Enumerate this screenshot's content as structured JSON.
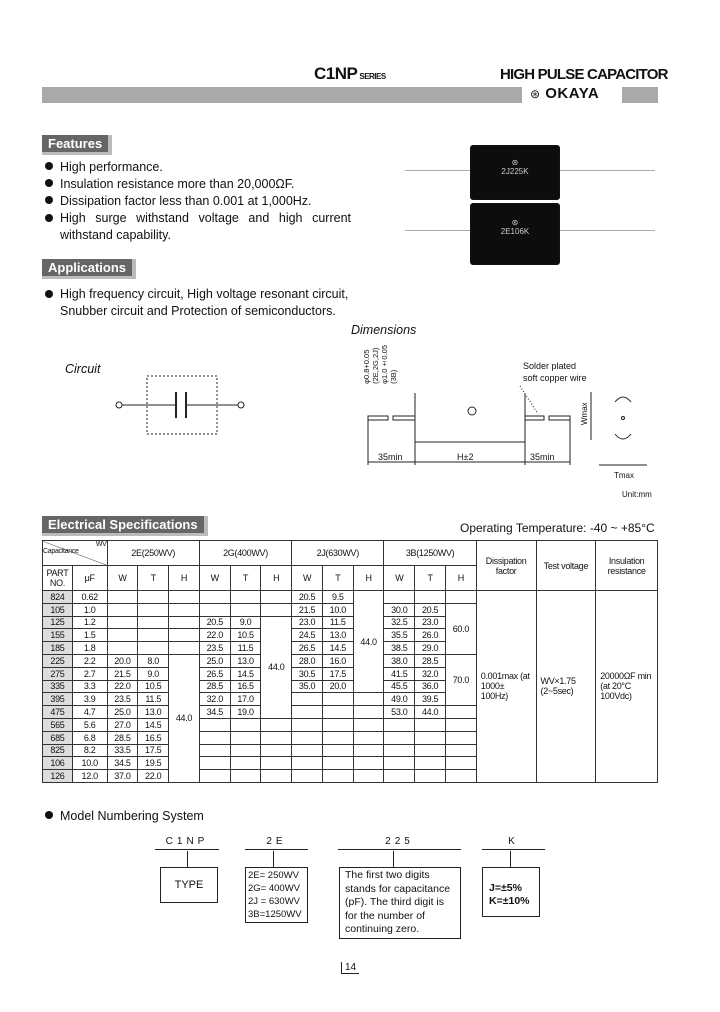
{
  "header": {
    "series": "C1NP",
    "series_suffix": "SERIES",
    "product_title": "HIGH PULSE CAPACITOR",
    "brand": "OKAYA",
    "bar_color": "#a9a9a9"
  },
  "features": {
    "title": "Features",
    "items": [
      "High performance.",
      "Insulation resistance more than 20,000ΩF.",
      "Dissipation factor less than 0.001 at 1,000Hz.",
      "High surge withstand voltage and high current withstand capability."
    ]
  },
  "photo": {
    "labels": [
      "2J225K",
      "2E106K"
    ]
  },
  "applications": {
    "title": "Applications",
    "text": "High frequency circuit, High voltage resonant circuit, Snubber circuit and Protection of semiconductors."
  },
  "circuit": {
    "label": "Circuit"
  },
  "dimensions": {
    "title": "Dimensions",
    "lead_dia_1": "φ0.8+0.05",
    "lead_dia_1_note": "(2E,2G,2J)",
    "lead_dia_2": "φ1.0±0.05",
    "lead_dia_2_note": "(3B)",
    "wire_note_1": "Solder plated",
    "wire_note_2": "soft copper wire",
    "lead_len_left": "35min",
    "body_len": "H±2",
    "lead_len_right": "35min",
    "wmax": "Wmax",
    "tmax": "Tmax",
    "unit": "Unit:mm"
  },
  "spec": {
    "title": "Electrical Specifications",
    "operating_temp": "Operating Temperature: -40 ~ +85°C",
    "corner_wv": "WV",
    "corner_cap": "Capacitance",
    "part_no": "PART NO.",
    "uf": "μF",
    "groups": [
      "2E(250WV)",
      "2G(400WV)",
      "2J(630WV)",
      "3B(1250WV)"
    ],
    "sub": [
      "W",
      "T",
      "H"
    ],
    "dissipation_header": "Dissipation factor",
    "test_header": "Test voltage",
    "insulation_header": "Insulation resistance",
    "dissipation": "0.001max (at 1000± 100Hz)",
    "test": "WV×1.75 (2~5sec)",
    "insulation": "20000ΩF min (at 20°C 100Vdc)",
    "h_2E": "44.0",
    "h_2G": "44.0",
    "h_2J": "44.0",
    "h_3B_a": "60.0",
    "h_3B_b": "70.0",
    "rows": [
      [
        "824",
        "0.62",
        "",
        "",
        "",
        "",
        "20.5",
        "9.5",
        "",
        ""
      ],
      [
        "105",
        "1.0",
        "",
        "",
        "",
        "",
        "21.5",
        "10.0",
        "30.0",
        "20.5"
      ],
      [
        "125",
        "1.2",
        "",
        "",
        "20.5",
        "9.0",
        "23.0",
        "11.5",
        "32.5",
        "23.0"
      ],
      [
        "155",
        "1.5",
        "",
        "",
        "22.0",
        "10.5",
        "24.5",
        "13.0",
        "35.5",
        "26.0"
      ],
      [
        "185",
        "1.8",
        "",
        "",
        "23.5",
        "11.5",
        "26.5",
        "14.5",
        "38.5",
        "29.0"
      ],
      [
        "225",
        "2.2",
        "20.0",
        "8.0",
        "25.0",
        "13.0",
        "28.0",
        "16.0",
        "38.0",
        "28.5"
      ],
      [
        "275",
        "2.7",
        "21.5",
        "9.0",
        "26.5",
        "14.5",
        "30.5",
        "17.5",
        "41.5",
        "32.0"
      ],
      [
        "335",
        "3.3",
        "22.0",
        "10.5",
        "28.5",
        "16.5",
        "35.0",
        "20.0",
        "45.5",
        "36.0"
      ],
      [
        "395",
        "3.9",
        "23.5",
        "11.5",
        "32.0",
        "17.0",
        "",
        "",
        "49.0",
        "39.5"
      ],
      [
        "475",
        "4.7",
        "25.0",
        "13.0",
        "34.5",
        "19.0",
        "",
        "",
        "53.0",
        "44.0"
      ],
      [
        "565",
        "5.6",
        "27.0",
        "14.5",
        "",
        "",
        "",
        "",
        "",
        ""
      ],
      [
        "685",
        "6.8",
        "28.5",
        "16.5",
        "",
        "",
        "",
        "",
        "",
        ""
      ],
      [
        "825",
        "8.2",
        "33.5",
        "17.5",
        "",
        "",
        "",
        "",
        "",
        ""
      ],
      [
        "106",
        "10.0",
        "34.5",
        "19.5",
        "",
        "",
        "",
        "",
        "",
        ""
      ],
      [
        "126",
        "12.0",
        "37.0",
        "22.0",
        "",
        "",
        "",
        "",
        "",
        ""
      ]
    ]
  },
  "model": {
    "title": "Model Numbering System",
    "codes": [
      "C1NP",
      "2E",
      "225",
      "K"
    ],
    "type_label": "TYPE",
    "voltage_codes": [
      "2E= 250WV",
      "2G= 400WV",
      "2J = 630WV",
      "3B=1250WV"
    ],
    "cap_text": "The first two digits stands for capacitance (pF). The third digit is for the number of continuing zero.",
    "tolerances": [
      "J=±5%",
      "K=±10%"
    ]
  },
  "page_number": "14"
}
